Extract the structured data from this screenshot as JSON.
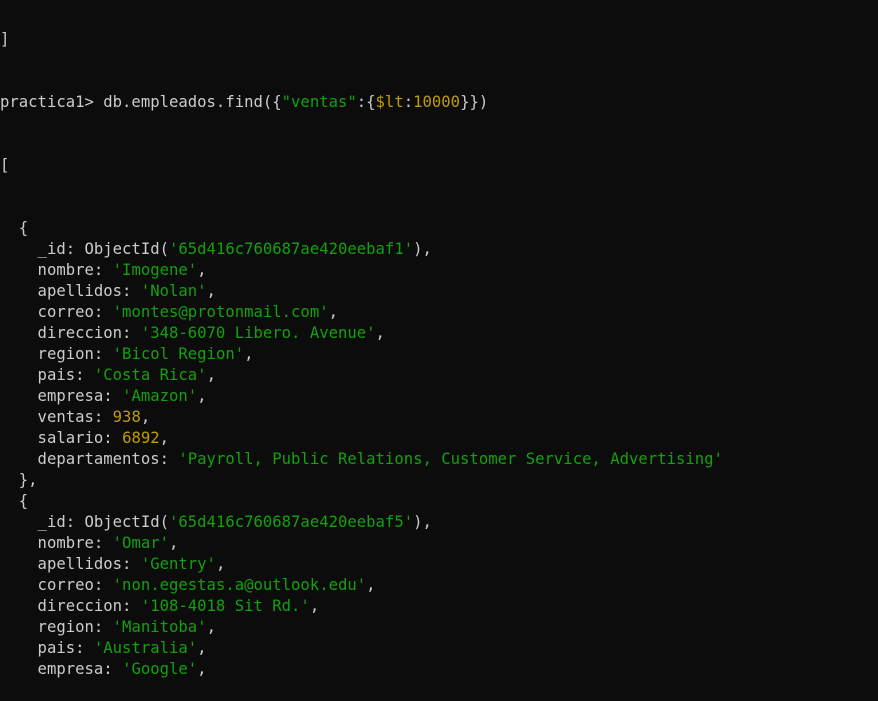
{
  "colors": {
    "background": "#0c0c0c",
    "text": "#cccccc",
    "string": "#13a10e",
    "number": "#c19c00"
  },
  "terminal": {
    "top_fragment": "]",
    "prompt": {
      "text": "practica1> db.empleados.find({",
      "query_key": "\"ventas\"",
      "colon_brace": ":{",
      "operator": "$lt",
      "colon": ":",
      "value": "10000",
      "closing": "}})"
    },
    "array_open": "[",
    "docs": [
      {
        "id_key": "_id: ObjectId(",
        "id_value": "'65d416c760687ae420eebaf1'",
        "fields": [
          {
            "key": "nombre: ",
            "value": "'Imogene'",
            "kind": "str"
          },
          {
            "key": "apellidos: ",
            "value": "'Nolan'",
            "kind": "str"
          },
          {
            "key": "correo: ",
            "value": "'montes@protonmail.com'",
            "kind": "str"
          },
          {
            "key": "direccion: ",
            "value": "'348-6070 Libero. Avenue'",
            "kind": "str"
          },
          {
            "key": "region: ",
            "value": "'Bicol Region'",
            "kind": "str"
          },
          {
            "key": "pais: ",
            "value": "'Costa Rica'",
            "kind": "str"
          },
          {
            "key": "empresa: ",
            "value": "'Amazon'",
            "kind": "str"
          },
          {
            "key": "ventas: ",
            "value": "938",
            "kind": "num"
          },
          {
            "key": "salario: ",
            "value": "6892",
            "kind": "num"
          },
          {
            "key": "departamentos: ",
            "value": "'Payroll, Public Relations, Customer Service, Advertising'",
            "kind": "str"
          }
        ]
      },
      {
        "id_key": "_id: ObjectId(",
        "id_value": "'65d416c760687ae420eebaf5'",
        "fields": [
          {
            "key": "nombre: ",
            "value": "'Omar'",
            "kind": "str"
          },
          {
            "key": "apellidos: ",
            "value": "'Gentry'",
            "kind": "str"
          },
          {
            "key": "correo: ",
            "value": "'non.egestas.a@outlook.edu'",
            "kind": "str"
          },
          {
            "key": "direccion: ",
            "value": "'108-4018 Sit Rd.'",
            "kind": "str"
          },
          {
            "key": "region: ",
            "value": "'Manitoba'",
            "kind": "str"
          },
          {
            "key": "pais: ",
            "value": "'Australia'",
            "kind": "str"
          },
          {
            "key": "empresa: ",
            "value": "'Google'",
            "kind": "str"
          }
        ]
      }
    ]
  }
}
